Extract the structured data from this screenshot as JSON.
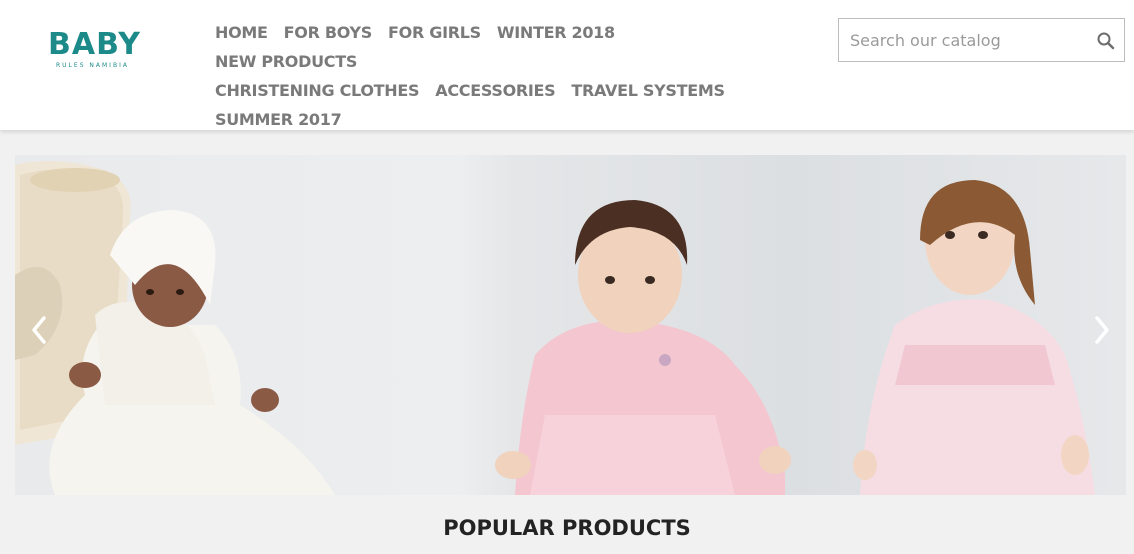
{
  "logo": {
    "main": "BABY",
    "sub": "RULES NAMIBIA"
  },
  "nav": {
    "items": [
      "HOME",
      "FOR BOYS",
      "FOR GIRLS",
      "WINTER 2018",
      "NEW PRODUCTS",
      "CHRISTENING CLOTHES",
      "ACCESSORIES",
      "TRAVEL SYSTEMS",
      "SUMMER 2017"
    ]
  },
  "search": {
    "placeholder": "Search our catalog",
    "icon": "search-icon"
  },
  "slider": {
    "prev_icon": "chevron-left-icon",
    "next_icon": "chevron-right-icon",
    "colors": {
      "accent": "#1d8a8a",
      "dress_pink": "#f4c6d0",
      "gown_white": "#f6f4ef"
    }
  },
  "section": {
    "title": "POPULAR PRODUCTS"
  }
}
